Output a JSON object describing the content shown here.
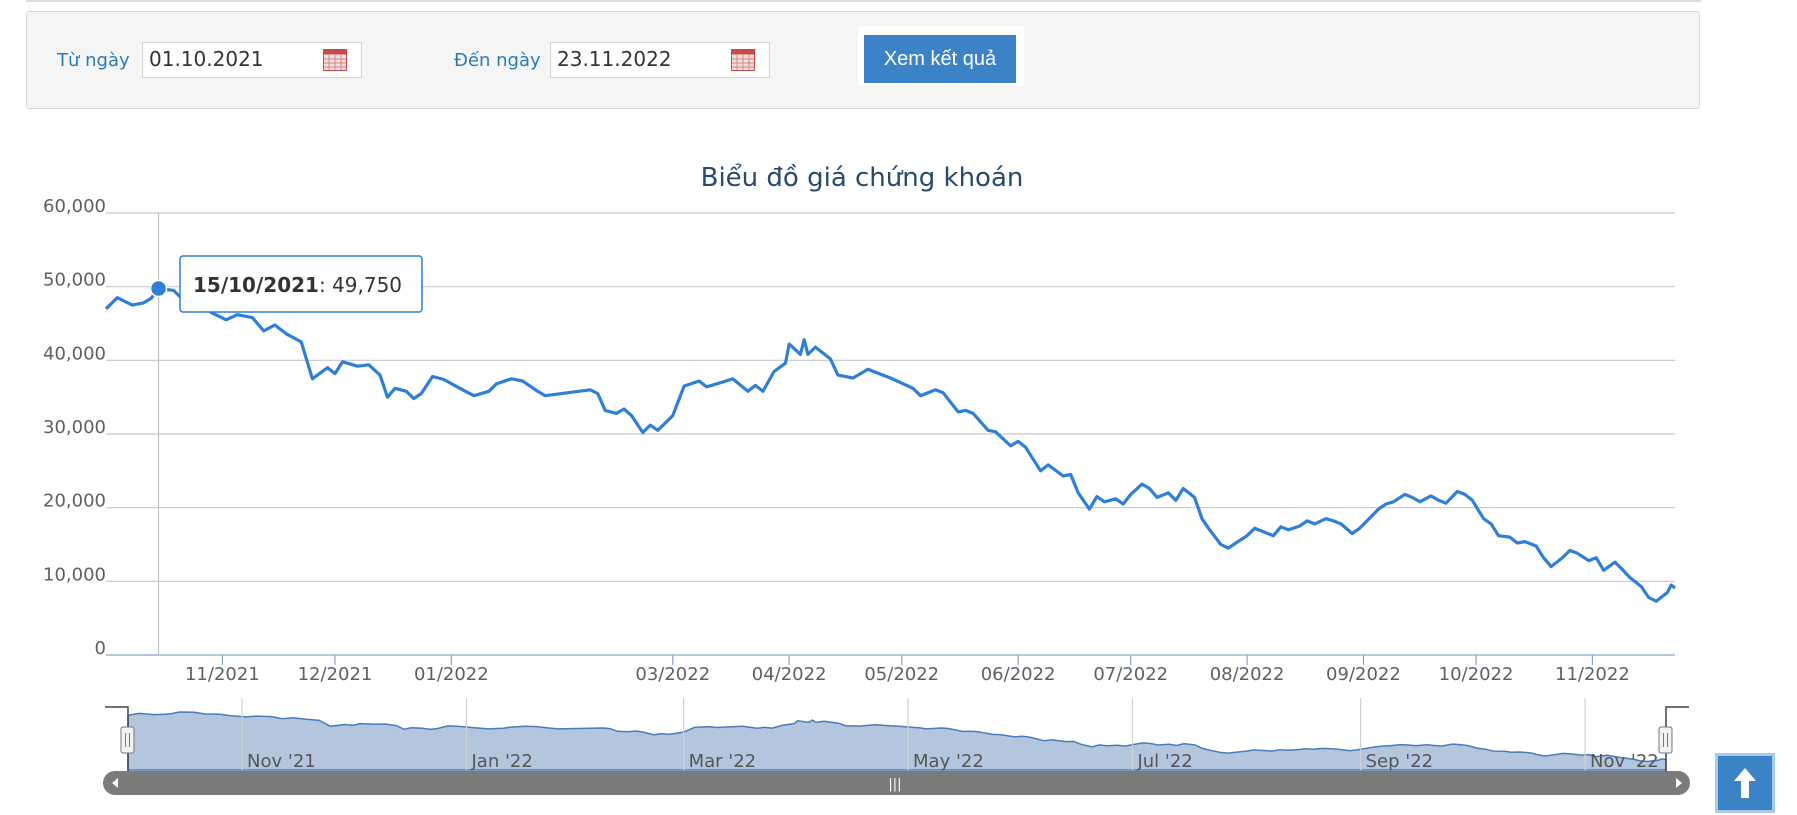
{
  "filter": {
    "from_label": "Từ ngày",
    "from_value": "01.10.2021",
    "to_label": "Đến ngày",
    "to_value": "23.11.2022",
    "submit_label": "Xem kết quả"
  },
  "tooltip": {
    "date": "15/10/2021",
    "value": "49,750"
  },
  "navigator": {
    "labels": [
      "Nov '21",
      "Jan '22",
      "Mar '22",
      "May '22",
      "Jul '22",
      "Sep '22",
      "Nov '22"
    ],
    "handle_glyph": "|||"
  },
  "chart_data": {
    "type": "line",
    "title": "Biểu đồ giá chứng khoán",
    "xlabel": "",
    "ylabel": "",
    "ylim": [
      0,
      60000
    ],
    "y_ticks": [
      "0",
      "10,000",
      "20,000",
      "30,000",
      "40,000",
      "50,000",
      "60,000"
    ],
    "x_ticks": [
      "11/2021",
      "12/2021",
      "01/2022",
      "03/2022",
      "04/2022",
      "05/2022",
      "06/2022",
      "07/2022",
      "08/2022",
      "09/2022",
      "10/2022",
      "11/2022"
    ],
    "grid": true,
    "series": [
      {
        "values": [
          {
            "x": "2021-10-01",
            "y": 47000
          },
          {
            "x": "2021-10-04",
            "y": 48500
          },
          {
            "x": "2021-10-06",
            "y": 48000
          },
          {
            "x": "2021-10-08",
            "y": 47500
          },
          {
            "x": "2021-10-11",
            "y": 47800
          },
          {
            "x": "2021-10-13",
            "y": 48400
          },
          {
            "x": "2021-10-15",
            "y": 49750
          },
          {
            "x": "2021-10-19",
            "y": 49500
          },
          {
            "x": "2021-10-22",
            "y": 48000
          },
          {
            "x": "2021-10-26",
            "y": 47800
          },
          {
            "x": "2021-10-29",
            "y": 46500
          },
          {
            "x": "2021-11-02",
            "y": 45500
          },
          {
            "x": "2021-11-05",
            "y": 46200
          },
          {
            "x": "2021-11-09",
            "y": 45800
          },
          {
            "x": "2021-11-12",
            "y": 44000
          },
          {
            "x": "2021-11-15",
            "y": 44800
          },
          {
            "x": "2021-11-18",
            "y": 43600
          },
          {
            "x": "2021-11-22",
            "y": 42500
          },
          {
            "x": "2021-11-25",
            "y": 37500
          },
          {
            "x": "2021-11-29",
            "y": 39000
          },
          {
            "x": "2021-12-01",
            "y": 38200
          },
          {
            "x": "2021-12-03",
            "y": 39800
          },
          {
            "x": "2021-12-07",
            "y": 39200
          },
          {
            "x": "2021-12-10",
            "y": 39400
          },
          {
            "x": "2021-12-13",
            "y": 38000
          },
          {
            "x": "2021-12-15",
            "y": 35000
          },
          {
            "x": "2021-12-17",
            "y": 36200
          },
          {
            "x": "2021-12-20",
            "y": 35800
          },
          {
            "x": "2021-12-22",
            "y": 34800
          },
          {
            "x": "2021-12-24",
            "y": 35500
          },
          {
            "x": "2021-12-27",
            "y": 37800
          },
          {
            "x": "2021-12-30",
            "y": 37400
          },
          {
            "x": "2022-01-04",
            "y": 36000
          },
          {
            "x": "2022-01-07",
            "y": 35200
          },
          {
            "x": "2022-01-11",
            "y": 35800
          },
          {
            "x": "2022-01-13",
            "y": 36800
          },
          {
            "x": "2022-01-17",
            "y": 37500
          },
          {
            "x": "2022-01-20",
            "y": 37200
          },
          {
            "x": "2022-01-24",
            "y": 35800
          },
          {
            "x": "2022-01-26",
            "y": 35200
          },
          {
            "x": "2022-02-07",
            "y": 36000
          },
          {
            "x": "2022-02-09",
            "y": 35500
          },
          {
            "x": "2022-02-11",
            "y": 33200
          },
          {
            "x": "2022-02-14",
            "y": 32800
          },
          {
            "x": "2022-02-16",
            "y": 33400
          },
          {
            "x": "2022-02-18",
            "y": 32500
          },
          {
            "x": "2022-02-21",
            "y": 30200
          },
          {
            "x": "2022-02-23",
            "y": 31200
          },
          {
            "x": "2022-02-25",
            "y": 30500
          },
          {
            "x": "2022-03-01",
            "y": 32500
          },
          {
            "x": "2022-03-04",
            "y": 36500
          },
          {
            "x": "2022-03-08",
            "y": 37200
          },
          {
            "x": "2022-03-10",
            "y": 36400
          },
          {
            "x": "2022-03-14",
            "y": 37000
          },
          {
            "x": "2022-03-17",
            "y": 37500
          },
          {
            "x": "2022-03-21",
            "y": 35800
          },
          {
            "x": "2022-03-23",
            "y": 36600
          },
          {
            "x": "2022-03-25",
            "y": 35800
          },
          {
            "x": "2022-03-28",
            "y": 38500
          },
          {
            "x": "2022-03-31",
            "y": 39600
          },
          {
            "x": "2022-04-01",
            "y": 42200
          },
          {
            "x": "2022-04-04",
            "y": 40800
          },
          {
            "x": "2022-04-05",
            "y": 42800
          },
          {
            "x": "2022-04-06",
            "y": 40800
          },
          {
            "x": "2022-04-08",
            "y": 41800
          },
          {
            "x": "2022-04-12",
            "y": 40200
          },
          {
            "x": "2022-04-14",
            "y": 38000
          },
          {
            "x": "2022-04-18",
            "y": 37600
          },
          {
            "x": "2022-04-20",
            "y": 38200
          },
          {
            "x": "2022-04-22",
            "y": 38800
          },
          {
            "x": "2022-04-26",
            "y": 38000
          },
          {
            "x": "2022-04-28",
            "y": 37600
          },
          {
            "x": "2022-05-04",
            "y": 36200
          },
          {
            "x": "2022-05-06",
            "y": 35200
          },
          {
            "x": "2022-05-10",
            "y": 36000
          },
          {
            "x": "2022-05-12",
            "y": 35600
          },
          {
            "x": "2022-05-16",
            "y": 33000
          },
          {
            "x": "2022-05-18",
            "y": 33200
          },
          {
            "x": "2022-05-20",
            "y": 32800
          },
          {
            "x": "2022-05-24",
            "y": 30500
          },
          {
            "x": "2022-05-26",
            "y": 30300
          },
          {
            "x": "2022-05-30",
            "y": 28400
          },
          {
            "x": "2022-06-01",
            "y": 29000
          },
          {
            "x": "2022-06-03",
            "y": 28200
          },
          {
            "x": "2022-06-07",
            "y": 25000
          },
          {
            "x": "2022-06-09",
            "y": 25800
          },
          {
            "x": "2022-06-13",
            "y": 24300
          },
          {
            "x": "2022-06-15",
            "y": 24500
          },
          {
            "x": "2022-06-17",
            "y": 22000
          },
          {
            "x": "2022-06-20",
            "y": 19800
          },
          {
            "x": "2022-06-22",
            "y": 21500
          },
          {
            "x": "2022-06-24",
            "y": 20800
          },
          {
            "x": "2022-06-27",
            "y": 21200
          },
          {
            "x": "2022-06-29",
            "y": 20500
          },
          {
            "x": "2022-07-01",
            "y": 21800
          },
          {
            "x": "2022-07-04",
            "y": 23200
          },
          {
            "x": "2022-07-06",
            "y": 22600
          },
          {
            "x": "2022-07-08",
            "y": 21400
          },
          {
            "x": "2022-07-11",
            "y": 22000
          },
          {
            "x": "2022-07-13",
            "y": 21000
          },
          {
            "x": "2022-07-15",
            "y": 22600
          },
          {
            "x": "2022-07-18",
            "y": 21400
          },
          {
            "x": "2022-07-20",
            "y": 18500
          },
          {
            "x": "2022-07-22",
            "y": 17000
          },
          {
            "x": "2022-07-25",
            "y": 15000
          },
          {
            "x": "2022-07-27",
            "y": 14500
          },
          {
            "x": "2022-07-29",
            "y": 15200
          },
          {
            "x": "2022-08-01",
            "y": 16200
          },
          {
            "x": "2022-08-03",
            "y": 17200
          },
          {
            "x": "2022-08-05",
            "y": 16800
          },
          {
            "x": "2022-08-08",
            "y": 16200
          },
          {
            "x": "2022-08-10",
            "y": 17400
          },
          {
            "x": "2022-08-12",
            "y": 17000
          },
          {
            "x": "2022-08-15",
            "y": 17500
          },
          {
            "x": "2022-08-17",
            "y": 18200
          },
          {
            "x": "2022-08-19",
            "y": 17800
          },
          {
            "x": "2022-08-22",
            "y": 18500
          },
          {
            "x": "2022-08-24",
            "y": 18200
          },
          {
            "x": "2022-08-26",
            "y": 17800
          },
          {
            "x": "2022-08-29",
            "y": 16500
          },
          {
            "x": "2022-08-31",
            "y": 17200
          },
          {
            "x": "2022-09-05",
            "y": 19800
          },
          {
            "x": "2022-09-07",
            "y": 20500
          },
          {
            "x": "2022-09-09",
            "y": 20800
          },
          {
            "x": "2022-09-12",
            "y": 21800
          },
          {
            "x": "2022-09-14",
            "y": 21400
          },
          {
            "x": "2022-09-16",
            "y": 20800
          },
          {
            "x": "2022-09-19",
            "y": 21600
          },
          {
            "x": "2022-09-21",
            "y": 21000
          },
          {
            "x": "2022-09-23",
            "y": 20600
          },
          {
            "x": "2022-09-26",
            "y": 22200
          },
          {
            "x": "2022-09-28",
            "y": 21800
          },
          {
            "x": "2022-09-30",
            "y": 21000
          },
          {
            "x": "2022-10-03",
            "y": 18500
          },
          {
            "x": "2022-10-05",
            "y": 17800
          },
          {
            "x": "2022-10-07",
            "y": 16200
          },
          {
            "x": "2022-10-10",
            "y": 16000
          },
          {
            "x": "2022-10-12",
            "y": 15200
          },
          {
            "x": "2022-10-14",
            "y": 15400
          },
          {
            "x": "2022-10-17",
            "y": 14800
          },
          {
            "x": "2022-10-19",
            "y": 13200
          },
          {
            "x": "2022-10-21",
            "y": 12000
          },
          {
            "x": "2022-10-24",
            "y": 13200
          },
          {
            "x": "2022-10-26",
            "y": 14200
          },
          {
            "x": "2022-10-28",
            "y": 13800
          },
          {
            "x": "2022-10-31",
            "y": 12800
          },
          {
            "x": "2022-11-02",
            "y": 13200
          },
          {
            "x": "2022-11-04",
            "y": 11500
          },
          {
            "x": "2022-11-07",
            "y": 12600
          },
          {
            "x": "2022-11-09",
            "y": 11600
          },
          {
            "x": "2022-11-11",
            "y": 10500
          },
          {
            "x": "2022-11-14",
            "y": 9300
          },
          {
            "x": "2022-11-16",
            "y": 7800
          },
          {
            "x": "2022-11-18",
            "y": 7300
          },
          {
            "x": "2022-11-21",
            "y": 8500
          },
          {
            "x": "2022-11-22",
            "y": 9500
          },
          {
            "x": "2022-11-23",
            "y": 9100
          }
        ]
      }
    ]
  }
}
